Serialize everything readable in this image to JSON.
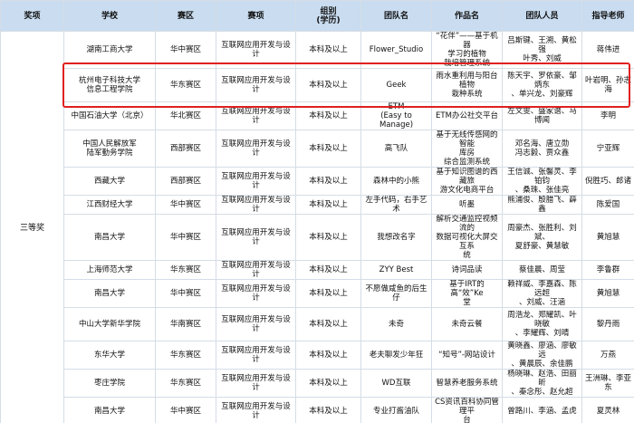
{
  "highlight_color": "#e02020",
  "header_bg": "#c9dcf0",
  "headers": {
    "award": "奖项",
    "school": "学校",
    "region": "赛区",
    "track": "赛项",
    "group": "组别\n(学历)",
    "team": "团队名",
    "work": "作品名",
    "members": "团队人员",
    "advisor": "指导老师"
  },
  "award_label": "三等奖",
  "rows": [
    {
      "school": "湖南工商大学",
      "region": "华中赛区",
      "track": "互联网应用开发与设计",
      "group": "本科及以上",
      "team": "Flower_Studio",
      "work": "“花伴”——基于机器\n学习的植物\n栽培管理系统",
      "members": "吕斯键、王溯、黄松强\n叶秀、刘威",
      "advisor": "蒋伟进"
    },
    {
      "school": "杭州电子科技大学\n信息工程学院",
      "region": "华东赛区",
      "track": "互联网应用开发与设计",
      "group": "本科及以上",
      "team": "Geek",
      "work": "雨水重利用与阳台植物\n栽种系统",
      "members": "陈天宇、罗依豪、邹炳东\n、单兴龙、刘豪辉",
      "advisor": "叶岩明、孙志海"
    },
    {
      "school": "中国石油大学（北京）",
      "region": "华北赛区",
      "track": "互联网应用开发与设计",
      "group": "本科及以上",
      "team": "ETM\n(Easy to Manage)",
      "work": "ETM办公社交平台",
      "members": "左文雯、盛家谱、马博闻",
      "advisor": "李明"
    },
    {
      "school": "中国人民解放军\n陆军勤务学院",
      "region": "西部赛区",
      "track": "互联网应用开发与设计",
      "group": "本科及以上",
      "team": "高飞队",
      "work": "基于无线传感网的智能\n库房\n综合监测系统",
      "members": "邓名海、唐立勋\n冯志毅、贾众鑫",
      "advisor": "宁亚辉"
    },
    {
      "school": "西藏大学",
      "region": "西部赛区",
      "track": "互联网应用开发与设计",
      "group": "本科及以上",
      "team": "森林中的小熊",
      "work": "基于知识图谱的西藏旅\n游文化电商平台",
      "members": "王信诚、张馨灵、李铂钧\n、桑珠、张佳亮",
      "advisor": "倪胜巧、郎诸"
    },
    {
      "school": "江西财经大学",
      "region": "华中赛区",
      "track": "互联网应用开发与设计",
      "group": "本科及以上",
      "team": "左手代码，右手艺术",
      "work": "听墨",
      "members": "熊浦俊、殷腊飞、薛鑫",
      "advisor": "陈爱国"
    },
    {
      "school": "南昌大学",
      "region": "华中赛区",
      "track": "互联网应用开发与设计",
      "group": "本科及以上",
      "team": "我想改名字",
      "work": "解析交通监控视频流的\n数据可视化大屏交互系\n统",
      "members": "周豪杰、张胜利、刘斌、\n夏舒豪、黄慧敏",
      "advisor": "黄旭慧"
    },
    {
      "school": "上海师范大学",
      "region": "华东赛区",
      "track": "互联网应用开发与设计",
      "group": "本科及以上",
      "team": "ZYY Best",
      "work": "诗词品读",
      "members": "蔡佳晨、周莹",
      "advisor": "李鲁群"
    },
    {
      "school": "南昌大学",
      "region": "华中赛区",
      "track": "互联网应用开发与设计",
      "group": "本科及以上",
      "team": "不愿做咸鱼的后生仔",
      "work": "基于IRT的高“效”Ke\n堂",
      "members": "赖祥威、李嘉森、陈远超\n、刘威、汪涵",
      "advisor": "黄旭慧"
    },
    {
      "school": "中山大学新华学院",
      "region": "华南赛区",
      "track": "互联网应用开发与设计",
      "group": "本科及以上",
      "team": "未奇",
      "work": "未奇云餐",
      "members": "周浩龙、郑耀凯、叶晓敏\n、李耀辉、刘晴",
      "advisor": "黎丹雨"
    },
    {
      "school": "东华大学",
      "region": "华东赛区",
      "track": "互联网应用开发与设计",
      "group": "本科及以上",
      "team": "老夫聊发少年狂",
      "work": "“知号”-网站设计",
      "members": "黄晓鑫、廖涵、廖敏远\n、黄晨辰、余佳鹏",
      "advisor": "万燕"
    },
    {
      "school": "枣庄学院",
      "region": "华东赛区",
      "track": "互联网应用开发与设计",
      "group": "本科及以上",
      "team": "WD互联",
      "work": "智慧养老服务系统",
      "members": "杨晓琳、赵浩、田丽昕\n、秦念彤、赵允超",
      "advisor": "王洲琳、李亚东"
    },
    {
      "school": "南昌大学",
      "region": "华中赛区",
      "track": "互联网应用开发与设计",
      "group": "本科及以上",
      "team": "专业打酱油队",
      "work": "CS资讯百科协同管理平\n台",
      "members": "曾路川、李涵、孟虎",
      "advisor": "夏灵林"
    }
  ]
}
